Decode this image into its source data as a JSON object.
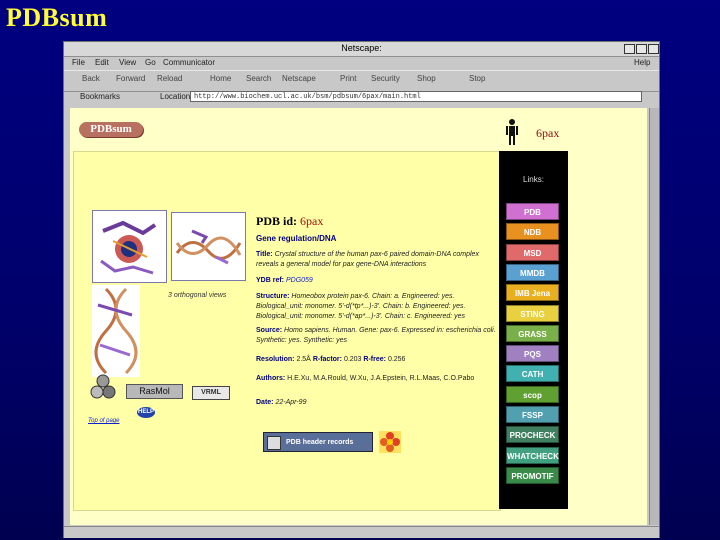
{
  "slide": {
    "title": "PDBsum"
  },
  "window": {
    "title": "Netscape:"
  },
  "menu": {
    "items": [
      "File",
      "Edit",
      "View",
      "Go",
      "Communicator"
    ],
    "help": "Help"
  },
  "toolbar": {
    "items": [
      "Back",
      "Forward",
      "Reload",
      "Home",
      "Search",
      "Netscape",
      "Print",
      "Security",
      "Shop",
      "Stop"
    ]
  },
  "location": {
    "bookmarks": "Bookmarks",
    "label": "Location:",
    "url": "http://www.biochem.ucl.ac.uk/bsm/pdbsum/6pax/main.html"
  },
  "page": {
    "logo": "PDBsum",
    "pdb_code": "6pax",
    "orthogonal": "3 orthogonal views",
    "rasmol": "RasMol",
    "vrml": "VRML",
    "help": "HELP",
    "up_link": "Top of page",
    "pdb_id_label": "PDB id:",
    "pdb_id": "6pax",
    "classification": "Gene regulation/DNA",
    "title_label": "Title:",
    "title_text": "Crystal structure of the human pax-6 paired domain-DNA complex reveals a general model for pax gene-DNA interactions",
    "ydb_label": "YDB ref:",
    "ydb_ref": "PDG059",
    "structure_label": "Structure:",
    "structure_text": "Homeobox protein pax-6. Chain: a. Engineered: yes. Biological_unit: monomer. 5'-d(*tp*...)-3'. Chain: b. Engineered: yes. Biological_unit: monomer. 5'-d(*ap*...)-3'. Chain: c. Engineered: yes",
    "source_label": "Source:",
    "source_text": "Homo sapiens. Human. Gene: pax-6. Expressed in: escherichia coli. Synthetic: yes. Synthetic: yes",
    "resolution_label": "Resolution:",
    "resolution": "2.5Å",
    "rfactor_label": "R-factor:",
    "rfactor": "0.203",
    "rfree_label": "R-free:",
    "rfree": "0.256",
    "authors_label": "Authors:",
    "authors": "H.E.Xu, M.A.Rould, W.Xu, J.A.Epstein, R.L.Maas, C.O.Pabo",
    "date_label": "Date:",
    "date": "22-Apr-99",
    "header_button": "PDB header records",
    "links_heading": "Links:"
  },
  "links": [
    {
      "label": "PDB",
      "color": "#d070d0"
    },
    {
      "label": "NDB",
      "color": "#e89020"
    },
    {
      "label": "MSD",
      "color": "#e06a6a"
    },
    {
      "label": "MMDB",
      "color": "#5aa0d0"
    },
    {
      "label": "IMB Jena",
      "color": "#e8b020"
    },
    {
      "label": "STING",
      "color": "#e8d040"
    },
    {
      "label": "GRASS",
      "color": "#7ab04a"
    },
    {
      "label": "PQS",
      "color": "#a080c0"
    },
    {
      "label": "CATH",
      "color": "#40b0b0"
    },
    {
      "label": "scop",
      "color": "#60a030"
    },
    {
      "label": "FSSP",
      "color": "#50a0b0"
    },
    {
      "label": "PROCHECK",
      "color": "#408060"
    },
    {
      "label": "WHATCHECK",
      "color": "#40a080"
    },
    {
      "label": "PROMOTIF",
      "color": "#3a8a4a"
    }
  ]
}
